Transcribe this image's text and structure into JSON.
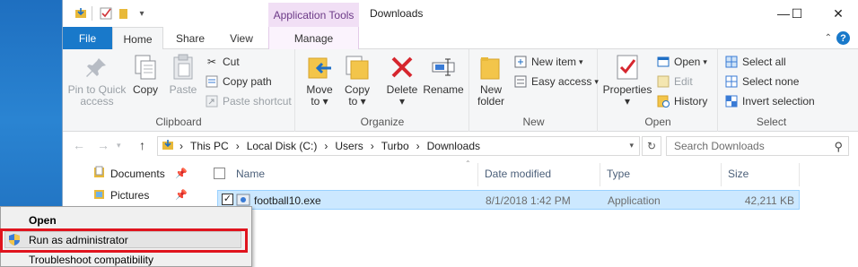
{
  "window": {
    "title": "Downloads",
    "context_tab_group": "Application Tools",
    "controls": {
      "minimize": "—",
      "maximize": "☐",
      "close": "✕"
    }
  },
  "tabs": {
    "file": "File",
    "home": "Home",
    "share": "Share",
    "view": "View",
    "manage": "Manage"
  },
  "ribbon": {
    "clipboard": {
      "label": "Clipboard",
      "pin_line1": "Pin to Quick",
      "pin_line2": "access",
      "copy": "Copy",
      "paste": "Paste",
      "cut": "Cut",
      "copy_path": "Copy path",
      "paste_shortcut": "Paste shortcut"
    },
    "organize": {
      "label": "Organize",
      "move_line1": "Move",
      "move_line2": "to",
      "copy_line1": "Copy",
      "copy_line2": "to",
      "delete": "Delete",
      "rename": "Rename"
    },
    "new": {
      "label": "New",
      "new_folder_line1": "New",
      "new_folder_line2": "folder",
      "new_item": "New item",
      "easy_access": "Easy access"
    },
    "open": {
      "label": "Open",
      "properties": "Properties",
      "open": "Open",
      "edit": "Edit",
      "history": "History"
    },
    "select": {
      "label": "Select",
      "select_all": "Select all",
      "select_none": "Select none",
      "invert": "Invert selection"
    }
  },
  "address": {
    "crumbs": [
      "This PC",
      "Local Disk (C:)",
      "Users",
      "Turbo",
      "Downloads"
    ],
    "search_placeholder": "Search Downloads"
  },
  "nav_pane": {
    "items": [
      "Documents",
      "Pictures"
    ]
  },
  "file_list": {
    "columns": {
      "name": "Name",
      "date": "Date modified",
      "type": "Type",
      "size": "Size"
    },
    "rows": [
      {
        "name": "football10.exe",
        "date": "8/1/2018 1:42 PM",
        "type": "Application",
        "size": "42,211 KB"
      }
    ]
  },
  "context_menu": {
    "items": [
      "Open",
      "Run as administrator",
      "Troubleshoot compatibility"
    ],
    "highlighted": "Run as administrator"
  },
  "colors": {
    "accent": "#1979ca",
    "context_tab": "#f1dff5",
    "selection": "#cce8ff",
    "highlight_box": "#e0141e"
  }
}
